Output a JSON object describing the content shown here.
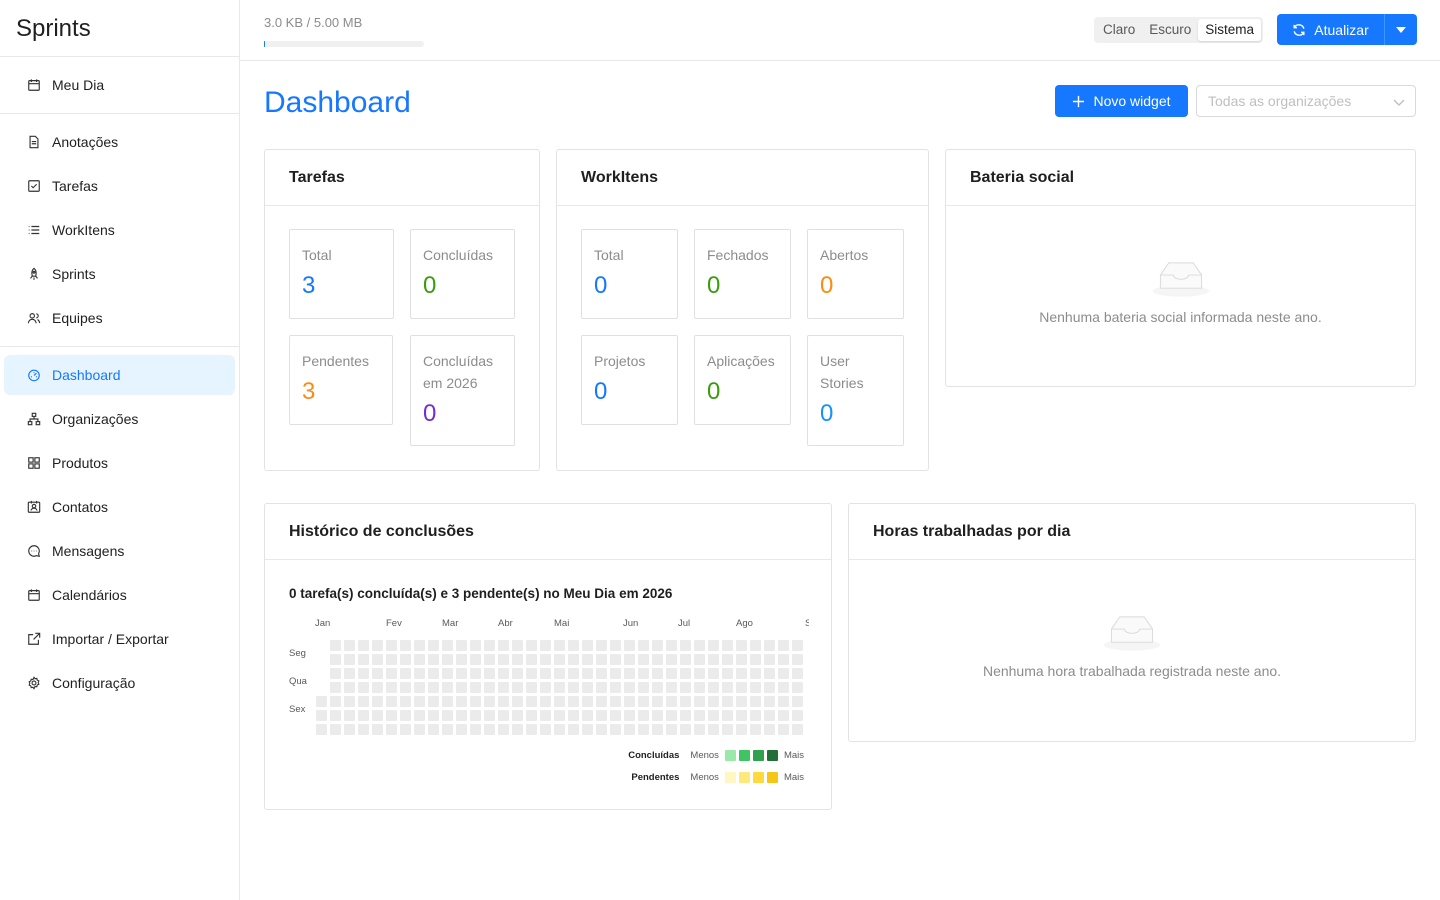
{
  "app": {
    "title": "Sprints"
  },
  "sidebar": {
    "groups": [
      [
        {
          "label": "Meu Dia",
          "icon": "calendar-icon"
        }
      ],
      [
        {
          "label": "Anotações",
          "icon": "file-icon"
        },
        {
          "label": "Tarefas",
          "icon": "checkbox-icon"
        },
        {
          "label": "WorkItens",
          "icon": "list-icon"
        },
        {
          "label": "Sprints",
          "icon": "rocket-icon"
        },
        {
          "label": "Equipes",
          "icon": "team-icon"
        }
      ],
      [
        {
          "label": "Dashboard",
          "icon": "dashboard-icon",
          "active": true
        },
        {
          "label": "Organizações",
          "icon": "cluster-icon"
        },
        {
          "label": "Produtos",
          "icon": "grid-icon"
        },
        {
          "label": "Contatos",
          "icon": "contacts-icon"
        },
        {
          "label": "Mensagens",
          "icon": "message-icon"
        },
        {
          "label": "Calendários",
          "icon": "calendar-icon"
        },
        {
          "label": "Importar / Exportar",
          "icon": "export-icon"
        },
        {
          "label": "Configuração",
          "icon": "gear-icon"
        }
      ]
    ]
  },
  "header": {
    "storage_text": "3.0 KB / 5.00 MB",
    "storage_fraction": 0.0006,
    "theme_options": [
      "Claro",
      "Escuro",
      "Sistema"
    ],
    "theme_selected": "Sistema",
    "refresh_label": "Atualizar"
  },
  "page": {
    "title": "Dashboard",
    "new_widget_label": "Novo widget",
    "org_select_placeholder": "Todas as organizações"
  },
  "cards": {
    "tarefas": {
      "title": "Tarefas",
      "stats": [
        {
          "label": "Total",
          "value": "3",
          "color": "#1677ff"
        },
        {
          "label": "Concluídas",
          "value": "0",
          "color": "#389e0d"
        },
        {
          "label": "Pendentes",
          "value": "3",
          "color": "#fa8c16"
        },
        {
          "label": "Concluídas em 2026",
          "value": "0",
          "color": "#722ed1"
        }
      ]
    },
    "workitens": {
      "title": "WorkItens",
      "stats": [
        {
          "label": "Total",
          "value": "0",
          "color": "#1677ff"
        },
        {
          "label": "Fechados",
          "value": "0",
          "color": "#389e0d"
        },
        {
          "label": "Abertos",
          "value": "0",
          "color": "#fa8c16"
        },
        {
          "label": "Projetos",
          "value": "0",
          "color": "#1677ff"
        },
        {
          "label": "Aplicações",
          "value": "0",
          "color": "#389e0d"
        },
        {
          "label": "User Stories",
          "value": "0",
          "color": "#1890ff"
        }
      ]
    },
    "bateria": {
      "title": "Bateria social",
      "empty_text": "Nenhuma bateria social informada neste ano."
    },
    "historico": {
      "title": "Histórico de conclusões",
      "caption": "0 tarefa(s) concluída(s) e 3 pendente(s) no Meu Dia em 2026",
      "months": [
        "Jan",
        "Fev",
        "Mar",
        "Abr",
        "Mai",
        "Jun",
        "Jul",
        "Ago",
        "Set"
      ],
      "days": [
        "Seg",
        "Qua",
        "Sex"
      ],
      "legend": {
        "done_label": "Concluídas",
        "pending_label": "Pendentes",
        "less": "Menos",
        "more": "Mais",
        "done_colors": [
          "#9be9a8",
          "#40c463",
          "#30a14e",
          "#216e39"
        ],
        "pending_colors": [
          "#fff7c2",
          "#ffe97a",
          "#ffd93d",
          "#f5c518"
        ]
      }
    },
    "horas": {
      "title": "Horas trabalhadas por dia",
      "empty_text": "Nenhuma hora trabalhada registrada neste ano."
    }
  }
}
